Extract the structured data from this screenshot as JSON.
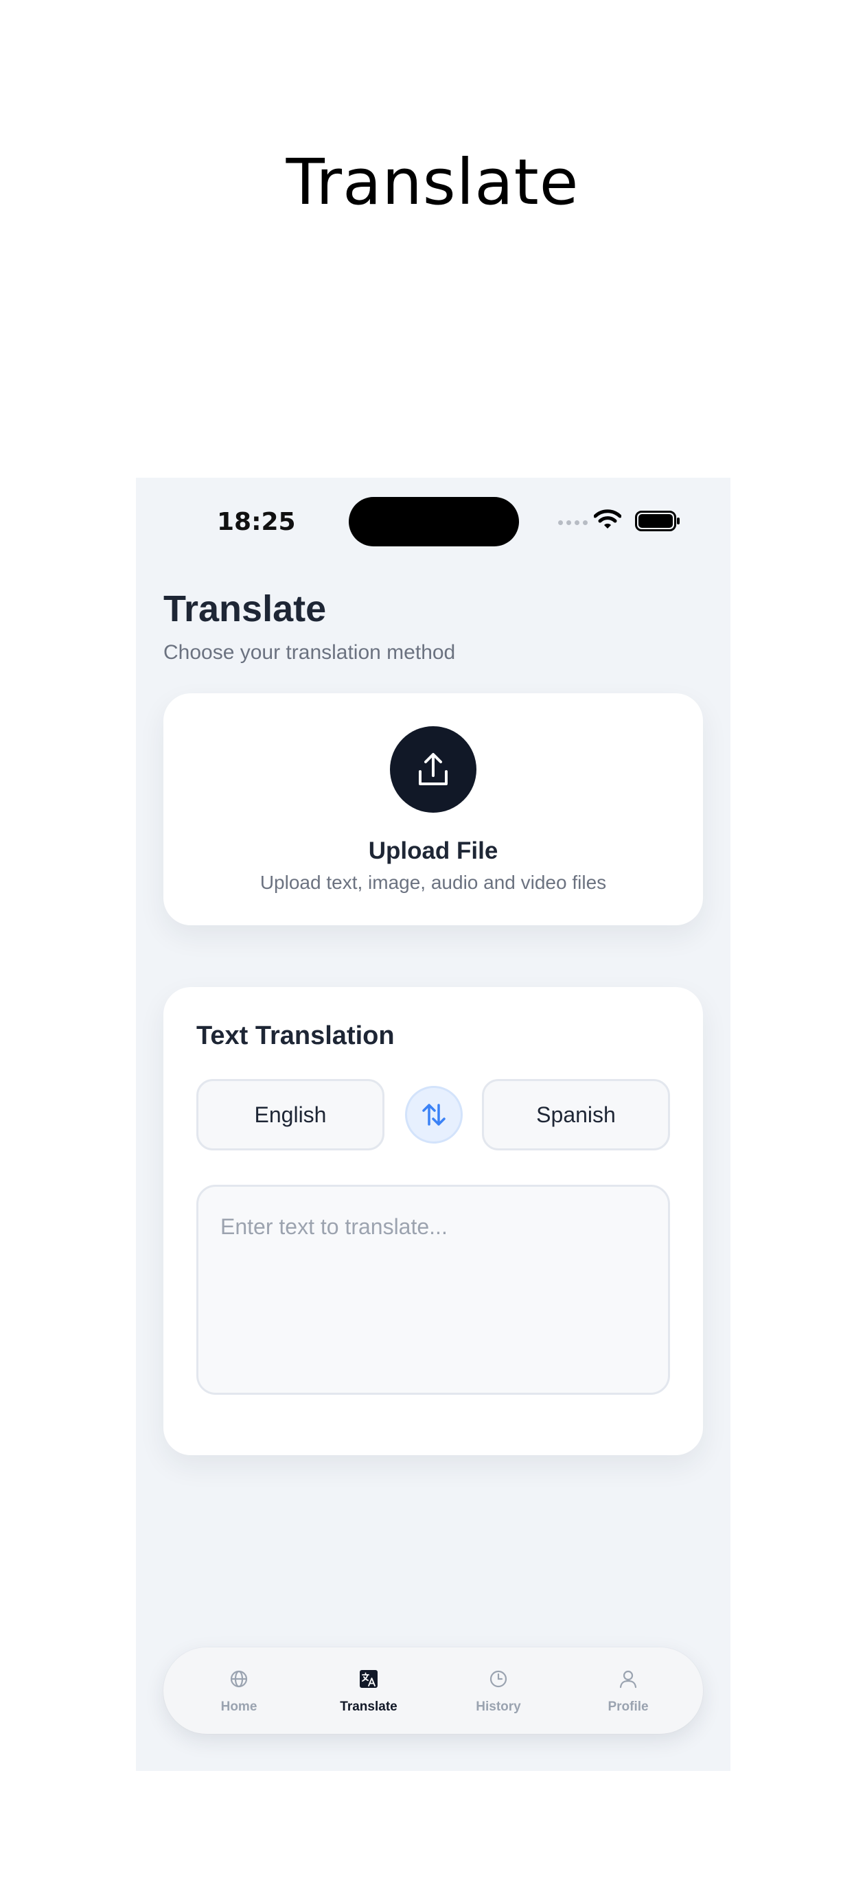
{
  "hero": {
    "title": "Translate"
  },
  "status_bar": {
    "time": "18:25"
  },
  "header": {
    "title": "Translate",
    "subtitle": "Choose your translation method"
  },
  "upload_card": {
    "icon": "upload-icon",
    "title": "Upload File",
    "description": "Upload text, image, audio and video files"
  },
  "text_translation": {
    "title": "Text Translation",
    "source_language": "English",
    "target_language": "Spanish",
    "swap_icon": "swap-arrows-icon",
    "input_value": "",
    "input_placeholder": "Enter text to translate..."
  },
  "tab_bar": {
    "active": "Translate",
    "items": [
      {
        "label": "Home",
        "icon": "globe-icon"
      },
      {
        "label": "Translate",
        "icon": "translate-icon"
      },
      {
        "label": "History",
        "icon": "clock-icon"
      },
      {
        "label": "Profile",
        "icon": "user-icon"
      }
    ]
  },
  "colors": {
    "accent": "#3b82f6",
    "dark": "#111827",
    "background": "#f1f4f8",
    "inactive_tab": "#9aa3b0"
  }
}
